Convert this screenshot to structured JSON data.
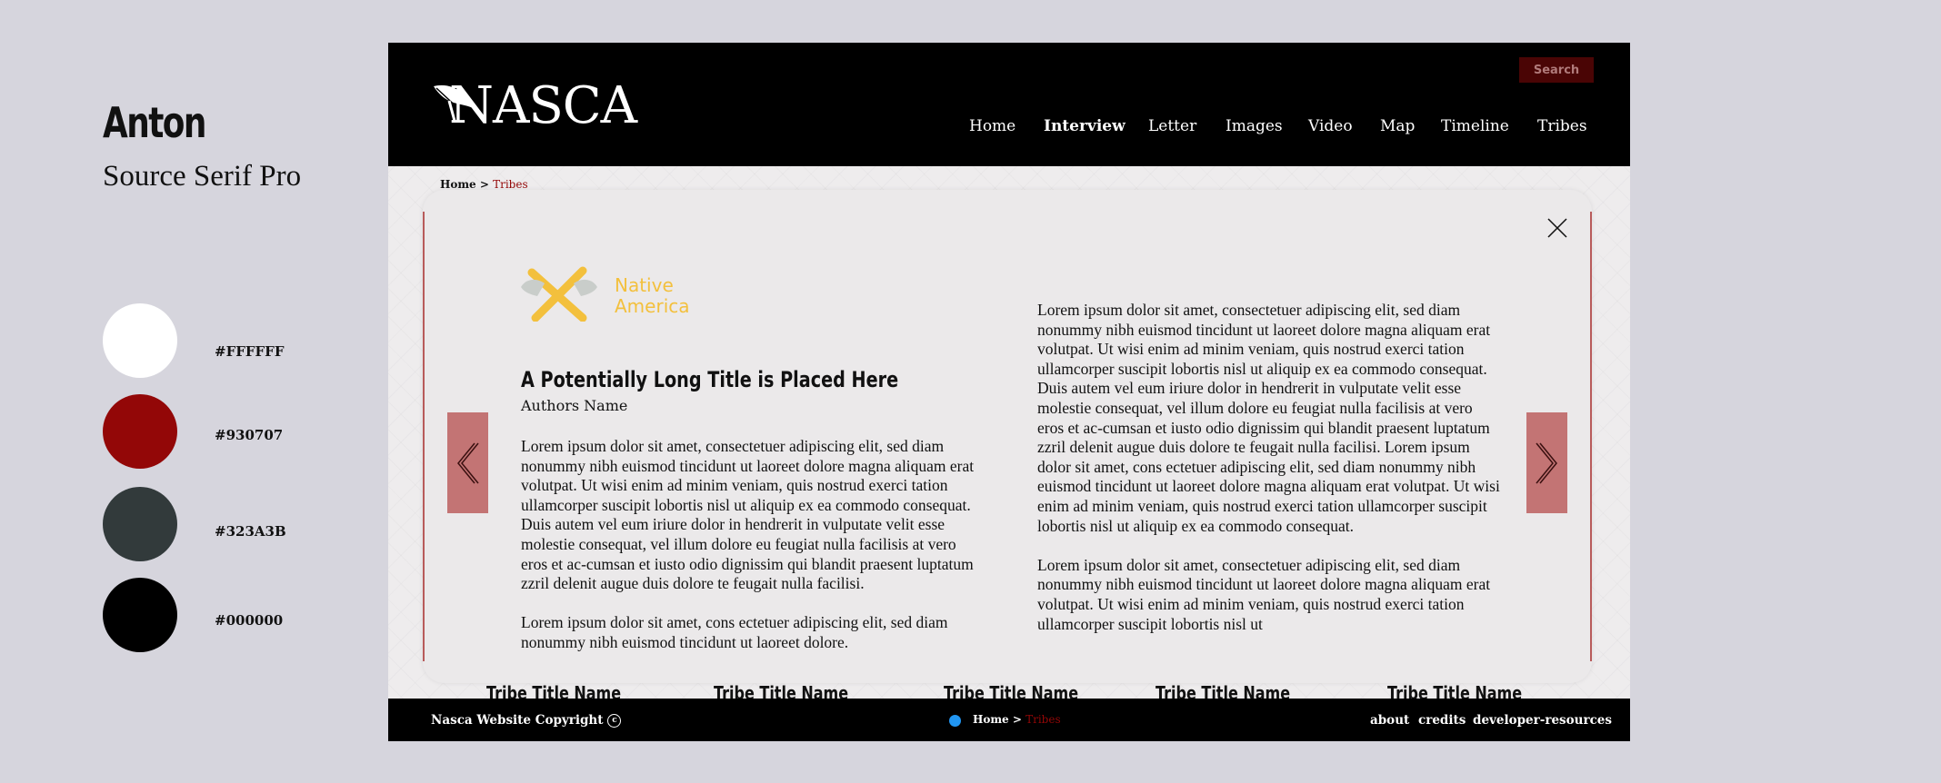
{
  "style_guide": {
    "fonts": [
      "Anton",
      "Source Serif Pro"
    ],
    "swatches": [
      {
        "color": "#FFFFFF",
        "label": "#FFFFFF"
      },
      {
        "color": "#930707",
        "label": "#930707"
      },
      {
        "color": "#323A3B",
        "label": "#323A3B"
      },
      {
        "color": "#000000",
        "label": "#000000"
      }
    ]
  },
  "header": {
    "logo_text": "NASCA",
    "logo_icon": "feather-icon",
    "search_label": "Search",
    "nav": [
      "Home",
      "Interview",
      "Letter",
      "Images",
      "Video",
      "Map",
      "Timeline",
      "Tribes"
    ],
    "active_nav": "Interview"
  },
  "breadcrumb": {
    "home": "Home >",
    "current": "Tribes"
  },
  "modal": {
    "brand_line1": "Native",
    "brand_line2": "America",
    "brand_icon": "crossed-axes-icon",
    "title": "A Potentially Long Title is Placed Here",
    "author": "Authors Name",
    "left_paragraphs": [
      "Lorem ipsum dolor sit amet, consectetuer adipiscing elit, sed diam nonummy nibh euismod tincidunt ut laoreet dolore magna aliquam erat volutpat. Ut wisi enim ad minim veniam, quis nostrud exerci tation ullamcorper suscipit lobortis nisl ut aliquip ex ea commodo consequat. Duis autem vel eum iriure dolor in hendrerit in vulputate velit esse molestie consequat, vel illum dolore eu feugiat nulla facilisis at vero eros et ac-cumsan et iusto odio dignissim qui blandit praesent luptatum zzril delenit augue duis dolore te feugait nulla facilisi.",
      "Lorem ipsum dolor sit amet, cons ectetuer adipiscing elit, sed diam nonummy nibh euismod tincidunt ut laoreet dolore."
    ],
    "right_paragraphs": [
      "Lorem ipsum dolor sit amet, consectetuer adipiscing elit, sed diam nonummy nibh euismod tincidunt ut laoreet dolore magna aliquam erat volutpat. Ut wisi enim ad minim veniam, quis nostrud exerci tation ullamcorper suscipit lobortis nisl ut aliquip ex ea commodo consequat. Duis autem vel eum iriure dolor in hendrerit in vulputate velit esse molestie consequat, vel illum dolore eu feugiat nulla facilisis at vero eros et ac-cumsan et iusto odio dignissim qui blandit praesent luptatum zzril delenit augue duis dolore te feugait nulla facilisi. Lorem ipsum dolor sit amet, cons ectetuer adipiscing elit, sed diam nonummy nibh euismod tincidunt ut laoreet dolore magna aliquam erat volutpat. Ut wisi enim ad minim veniam, quis nostrud exerci tation ullamcorper suscipit lobortis nisl ut aliquip ex ea commodo consequat.",
      "Lorem ipsum dolor sit amet, consectetuer adipiscing elit, sed diam nonummy nibh euismod tincidunt ut laoreet dolore magna aliquam erat volutpat. Ut wisi enim ad minim veniam, quis nostrud exerci tation ullamcorper suscipit lobortis nisl ut"
    ]
  },
  "tribe_titles": [
    "Tribe Title Name",
    "Tribe Title Name",
    "Tribe Title Name",
    "Tribe Title Name",
    "Tribe Title Name"
  ],
  "footer": {
    "copyright": "Nasca Website Copyright",
    "copyright_symbol": "c",
    "crumb_home": "Home >",
    "crumb_current": "Tribes",
    "links": [
      "about",
      "credits",
      "developer-resources"
    ]
  },
  "colors": {
    "accent": "#930707",
    "dark": "#323A3B",
    "brand_yellow": "#F3C03D"
  }
}
